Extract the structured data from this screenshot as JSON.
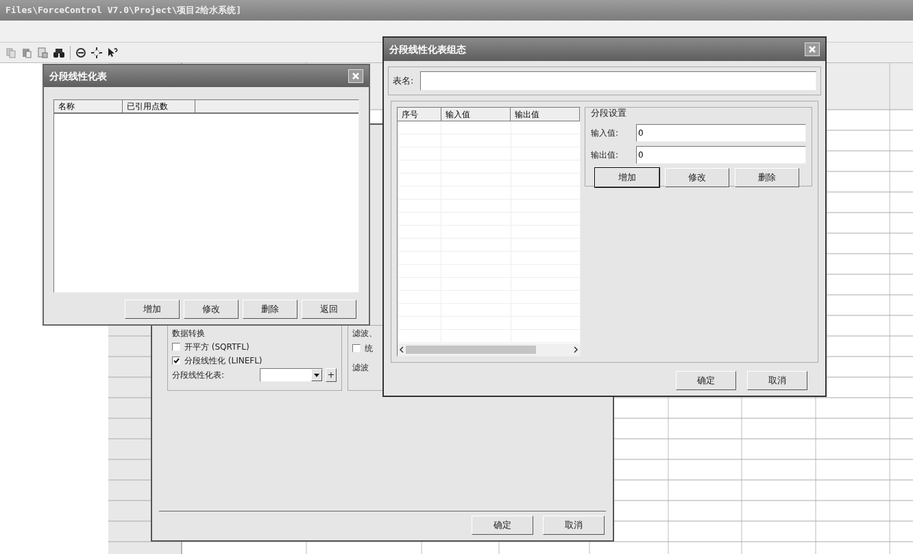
{
  "window": {
    "title": "Files\\ForceControl V7.0\\Project\\项目2给水系统]"
  },
  "config_dialog": {
    "group_title": "数据转换",
    "checkboxes": [
      {
        "label": "开平方 (SQRTFL)",
        "checked": false
      },
      {
        "label": "分段线性化 (LINEFL)",
        "checked": true
      }
    ],
    "table_label": "分段线性化表:",
    "plus_button": "+",
    "filter_group_title": "滤波、",
    "filter_checkbox": {
      "label": "统",
      "checked": false
    },
    "filter_label": "滤波",
    "buttons": [
      "确定",
      "取消"
    ]
  },
  "table_list_dialog": {
    "title": "分段线性化表",
    "columns": [
      "名称",
      "已引用点数"
    ],
    "buttons": [
      "增加",
      "修改",
      "删除",
      "返回"
    ]
  },
  "table_config_dialog": {
    "title": "分段线性化表组态",
    "name_label": "表名:",
    "columns": [
      "序号",
      "输入值",
      "输出值"
    ],
    "segment_group": {
      "title": "分段设置",
      "fields": [
        {
          "label": "输入值:",
          "value": "0"
        },
        {
          "label": "输出值:",
          "value": "0"
        }
      ],
      "buttons": [
        {
          "label": "增加",
          "focused": true
        },
        {
          "label": "修改",
          "focused": false
        },
        {
          "label": "删除",
          "focused": false
        }
      ]
    },
    "buttons": [
      "确定",
      "取消"
    ]
  }
}
